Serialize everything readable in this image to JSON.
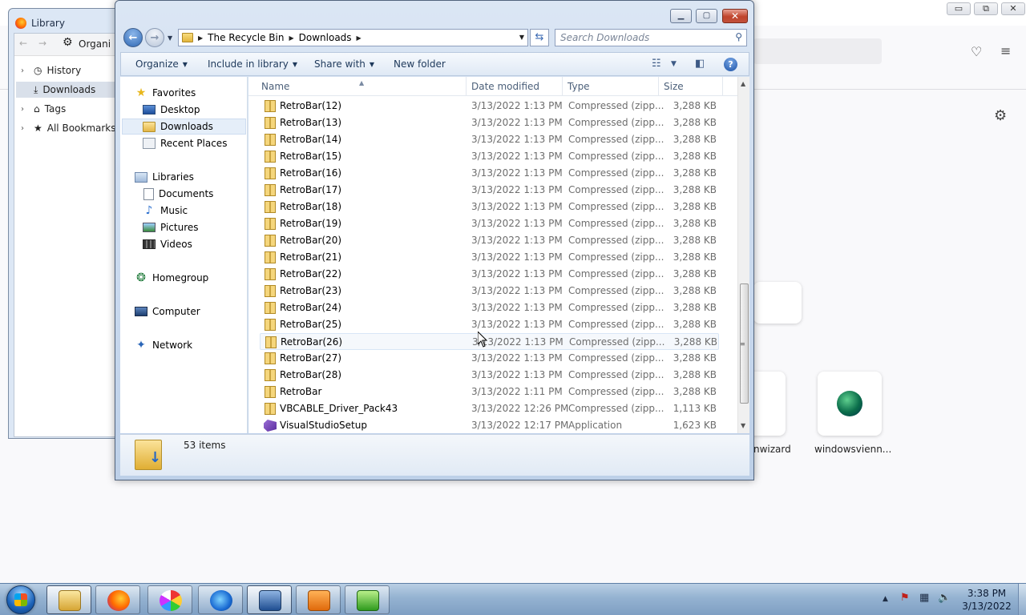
{
  "firefox": {
    "card_labels": [
      "nwizard",
      "windowsvienn..."
    ]
  },
  "library": {
    "title": "Library",
    "toolbar_label": "Organi",
    "tree": [
      "History",
      "Downloads",
      "Tags",
      "All Bookmarks"
    ]
  },
  "explorer": {
    "breadcrumb": [
      "The Recycle Bin",
      "Downloads"
    ],
    "search_placeholder": "Search Downloads",
    "commands": {
      "organize": "Organize",
      "include": "Include in library",
      "share": "Share with",
      "new_folder": "New folder"
    },
    "nav": {
      "favorites": "Favorites",
      "desktop": "Desktop",
      "downloads": "Downloads",
      "recent": "Recent Places",
      "libraries": "Libraries",
      "documents": "Documents",
      "music": "Music",
      "pictures": "Pictures",
      "videos": "Videos",
      "homegroup": "Homegroup",
      "computer": "Computer",
      "network": "Network"
    },
    "columns": {
      "name": "Name",
      "date": "Date modified",
      "type": "Type",
      "size": "Size"
    },
    "files": [
      {
        "name": "RetroBar(12)",
        "date": "3/13/2022 1:13 PM",
        "type": "Compressed (zipp...",
        "size": "3,288 KB"
      },
      {
        "name": "RetroBar(13)",
        "date": "3/13/2022 1:13 PM",
        "type": "Compressed (zipp...",
        "size": "3,288 KB"
      },
      {
        "name": "RetroBar(14)",
        "date": "3/13/2022 1:13 PM",
        "type": "Compressed (zipp...",
        "size": "3,288 KB"
      },
      {
        "name": "RetroBar(15)",
        "date": "3/13/2022 1:13 PM",
        "type": "Compressed (zipp...",
        "size": "3,288 KB"
      },
      {
        "name": "RetroBar(16)",
        "date": "3/13/2022 1:13 PM",
        "type": "Compressed (zipp...",
        "size": "3,288 KB"
      },
      {
        "name": "RetroBar(17)",
        "date": "3/13/2022 1:13 PM",
        "type": "Compressed (zipp...",
        "size": "3,288 KB"
      },
      {
        "name": "RetroBar(18)",
        "date": "3/13/2022 1:13 PM",
        "type": "Compressed (zipp...",
        "size": "3,288 KB"
      },
      {
        "name": "RetroBar(19)",
        "date": "3/13/2022 1:13 PM",
        "type": "Compressed (zipp...",
        "size": "3,288 KB"
      },
      {
        "name": "RetroBar(20)",
        "date": "3/13/2022 1:13 PM",
        "type": "Compressed (zipp...",
        "size": "3,288 KB"
      },
      {
        "name": "RetroBar(21)",
        "date": "3/13/2022 1:13 PM",
        "type": "Compressed (zipp...",
        "size": "3,288 KB"
      },
      {
        "name": "RetroBar(22)",
        "date": "3/13/2022 1:13 PM",
        "type": "Compressed (zipp...",
        "size": "3,288 KB"
      },
      {
        "name": "RetroBar(23)",
        "date": "3/13/2022 1:13 PM",
        "type": "Compressed (zipp...",
        "size": "3,288 KB"
      },
      {
        "name": "RetroBar(24)",
        "date": "3/13/2022 1:13 PM",
        "type": "Compressed (zipp...",
        "size": "3,288 KB"
      },
      {
        "name": "RetroBar(25)",
        "date": "3/13/2022 1:13 PM",
        "type": "Compressed (zipp...",
        "size": "3,288 KB"
      },
      {
        "name": "RetroBar(26)",
        "date": "3/13/2022 1:13 PM",
        "type": "Compressed (zipp...",
        "size": "3,288 KB"
      },
      {
        "name": "RetroBar(27)",
        "date": "3/13/2022 1:13 PM",
        "type": "Compressed (zipp...",
        "size": "3,288 KB"
      },
      {
        "name": "RetroBar(28)",
        "date": "3/13/2022 1:13 PM",
        "type": "Compressed (zipp...",
        "size": "3,288 KB"
      },
      {
        "name": "RetroBar",
        "date": "3/13/2022 1:11 PM",
        "type": "Compressed (zipp...",
        "size": "3,288 KB"
      },
      {
        "name": "VBCABLE_Driver_Pack43",
        "date": "3/13/2022 12:26 PM",
        "type": "Compressed (zipp...",
        "size": "1,113 KB"
      },
      {
        "name": "VisualStudioSetup",
        "date": "3/13/2022 12:17 PM",
        "type": "Application",
        "size": "1,623 KB"
      }
    ],
    "status": "53 items"
  },
  "taskbar": {
    "time": "3:38 PM",
    "date": "3/13/2022"
  }
}
